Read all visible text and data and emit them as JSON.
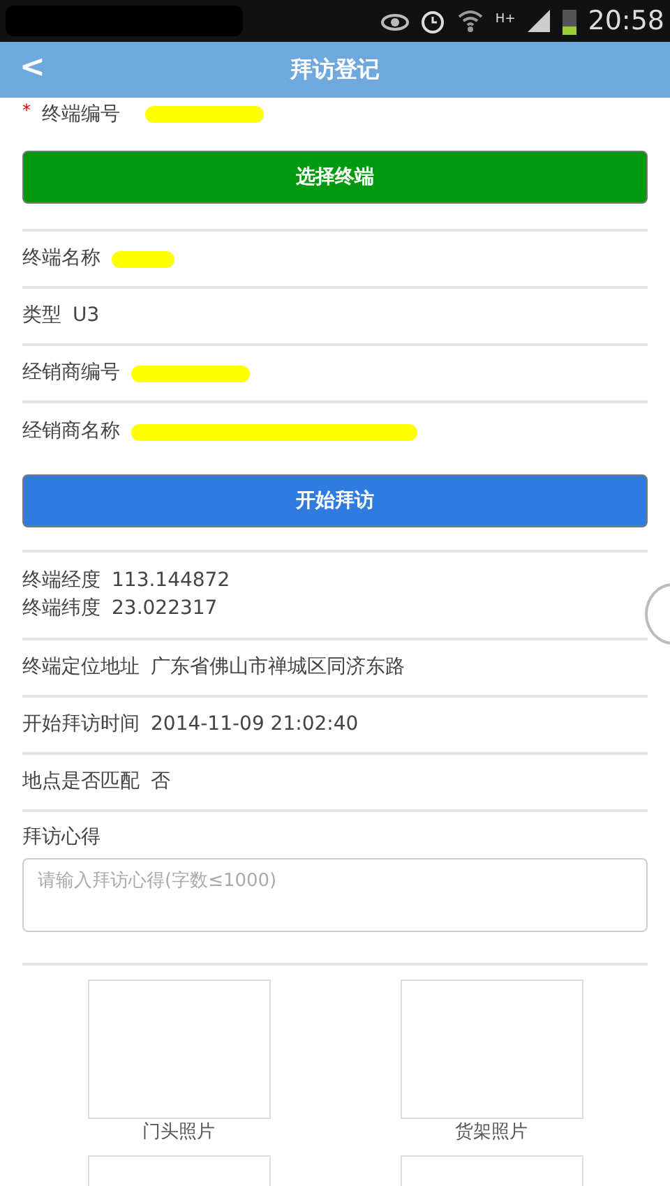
{
  "status_bar": {
    "network": "H+",
    "time": "20:58"
  },
  "header": {
    "back": "<",
    "title": "拜访登记"
  },
  "terminal_code": {
    "required_mark": "*",
    "label": "终端编号",
    "kind": "redacted"
  },
  "select_button": "选择终端",
  "info_rows": [
    {
      "label": "终端名称",
      "kind": "redacted"
    },
    {
      "label": "类型",
      "value": "U3",
      "kind": "text"
    },
    {
      "label": "经销商编号",
      "kind": "redacted"
    },
    {
      "label": "经销商名称",
      "kind": "redacted"
    }
  ],
  "start_button": "开始拜访",
  "coords": [
    {
      "label": "终端经度",
      "value": "113.144872"
    },
    {
      "label": "终端纬度",
      "value": "23.022317"
    }
  ],
  "visit_rows": [
    {
      "label": "终端定位地址",
      "value": "广东省佛山市禅城区同济东路"
    },
    {
      "label": "开始拜访时间",
      "value": "2014-11-09 21:02:40"
    },
    {
      "label": "地点是否匹配",
      "value": "否"
    }
  ],
  "notes": {
    "label": "拜访心得",
    "placeholder": "请输入拜访心得(字数≤1000)"
  },
  "photos": [
    {
      "kind": "labeled",
      "label": "门头照片"
    },
    {
      "kind": "labeled",
      "label": "货架照片"
    },
    {
      "kind": "unlabeled"
    },
    {
      "kind": "unlabeled"
    }
  ]
}
